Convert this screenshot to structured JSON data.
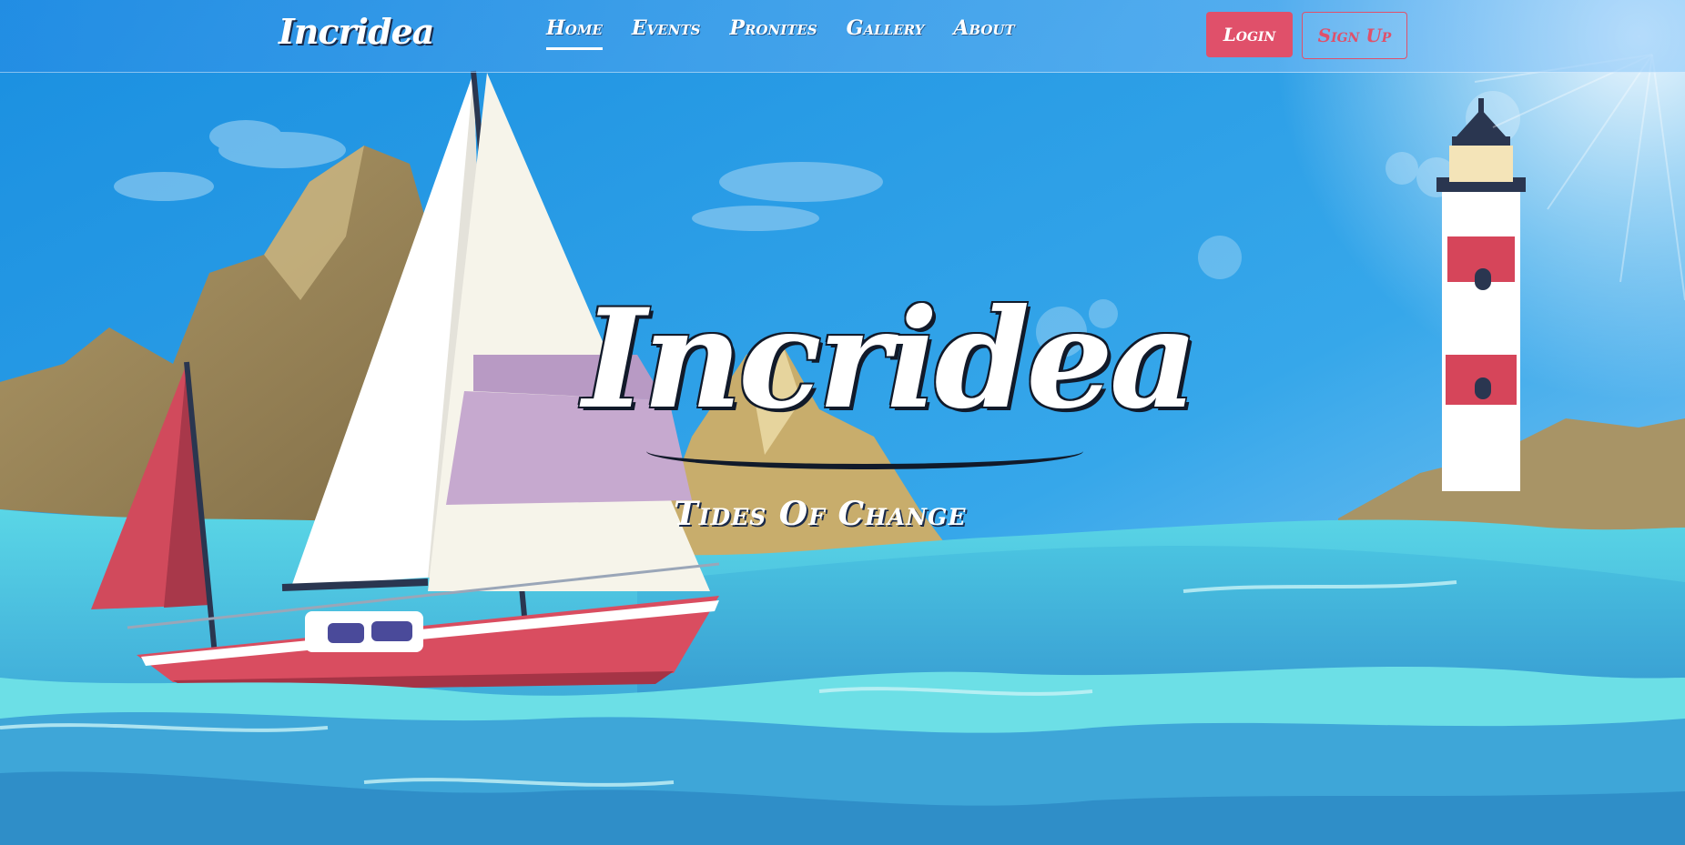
{
  "header": {
    "brand": "Incridea",
    "nav": [
      {
        "label": "Home",
        "active": true
      },
      {
        "label": "Events",
        "active": false
      },
      {
        "label": "Pronites",
        "active": false
      },
      {
        "label": "Gallery",
        "active": false
      },
      {
        "label": "About",
        "active": false
      }
    ],
    "login_label": "Login",
    "signup_label": "Sign Up"
  },
  "hero": {
    "title": "Incridea",
    "tagline": "Tides Of Change"
  },
  "colors": {
    "accent": "#e0506a",
    "sky": "#1ea2e6",
    "sea": "#3fc6dc"
  }
}
